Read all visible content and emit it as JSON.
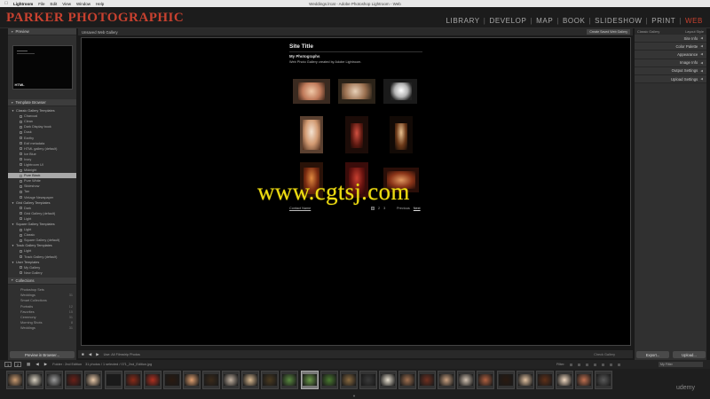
{
  "menubar": {
    "app": "Lightroom",
    "items": [
      "File",
      "Edit",
      "View",
      "Window",
      "Help"
    ],
    "window_title": "Weddings.lrcat - Adobe Photoshop Lightroom - Web",
    "clock": "Mon 4:53 PM",
    "user": "Chris Parker"
  },
  "identity_plate": "PARKER PHOTOGRAPHIC",
  "modules": [
    "LIBRARY",
    "DEVELOP",
    "MAP",
    "BOOK",
    "SLIDESHOW",
    "PRINT",
    "WEB"
  ],
  "active_module": "WEB",
  "left_panel": {
    "preview_title": "Preview",
    "preview_label": "HTML",
    "template_browser_title": "Template Browser",
    "templates": [
      {
        "label": "Classic Gallery Templates",
        "folder": true
      },
      {
        "label": "Charcoal"
      },
      {
        "label": "Clean"
      },
      {
        "label": "Dark Display book"
      },
      {
        "label": "Dusk"
      },
      {
        "label": "Earthy"
      },
      {
        "label": "Exif metadata"
      },
      {
        "label": "HTML gallery (default)"
      },
      {
        "label": "Ice Blue"
      },
      {
        "label": "Ivory"
      },
      {
        "label": "Lightroom UI"
      },
      {
        "label": "Midnight"
      },
      {
        "label": "Pure Black",
        "selected": true
      },
      {
        "label": "Pure White"
      },
      {
        "label": "Slideshow"
      },
      {
        "label": "Tan"
      },
      {
        "label": "Vintage Newspaper"
      },
      {
        "label": "Grid Gallery Templates",
        "folder": true
      },
      {
        "label": "Dark"
      },
      {
        "label": "Grid Gallery (default)"
      },
      {
        "label": "Light"
      },
      {
        "label": "Square Gallery Templates",
        "folder": true
      },
      {
        "label": "Light"
      },
      {
        "label": "Classic"
      },
      {
        "label": "Square Gallery (default)"
      },
      {
        "label": "Track Gallery Templates",
        "folder": true
      },
      {
        "label": "Light"
      },
      {
        "label": "Track Gallery (default)"
      },
      {
        "label": "User Templates",
        "folder": true
      },
      {
        "label": "My Gallery"
      },
      {
        "label": "New Gallery"
      }
    ],
    "collections_title": "Collections",
    "collections": [
      {
        "label": "Photoshop Sets",
        "count": ""
      },
      {
        "label": "Weddings",
        "count": "31"
      },
      {
        "label": "Smart Collections",
        "count": ""
      },
      {
        "label": "Portraits",
        "count": "12"
      },
      {
        "label": "Favorites",
        "count": "15"
      },
      {
        "label": "Ceremony",
        "count": "31"
      },
      {
        "label": "Morning Shots",
        "count": "8"
      },
      {
        "label": "Weddings",
        "count": "31"
      }
    ],
    "preview_button": "Preview in Browser..."
  },
  "center": {
    "header": "Unsaved Web Gallery",
    "header_badge": "Create Saved Web Gallery",
    "site_title": "Site Title",
    "collection_title": "My Photographs",
    "description": "Web Photo Gallery created by Adobe Lightroom.",
    "contact": "Contact Name",
    "page_numbers": [
      "1",
      "2",
      "3"
    ],
    "previous": "Previous",
    "next": "Next",
    "watermark": "www.cgtsj.com",
    "toolbar_source": "Use: All Filmstrip Photos",
    "toolbar_right": "Check Gallery"
  },
  "right_panel": {
    "top_left": "Classic Gallery",
    "top_right": "Layout Style",
    "sections": [
      "Site Info",
      "Color Palette",
      "Appearance",
      "Image Info",
      "Output Settings",
      "Upload Settings"
    ],
    "export_button": "Export...",
    "upload_button": "Upload..."
  },
  "filmstrip": {
    "source": "Folder : 2nd Edition",
    "info": "31 photos / 1 selected / 071_2nd_Edition.jpg",
    "filter_label": "Filter:",
    "filter_value": "My Filter",
    "count": 31,
    "selected_index": 15
  },
  "udemy": "udemy",
  "colors": {
    "accent": "#c8412f",
    "watermark": "#eddc12",
    "panel": "#303030",
    "background": "#1a1a1a"
  }
}
